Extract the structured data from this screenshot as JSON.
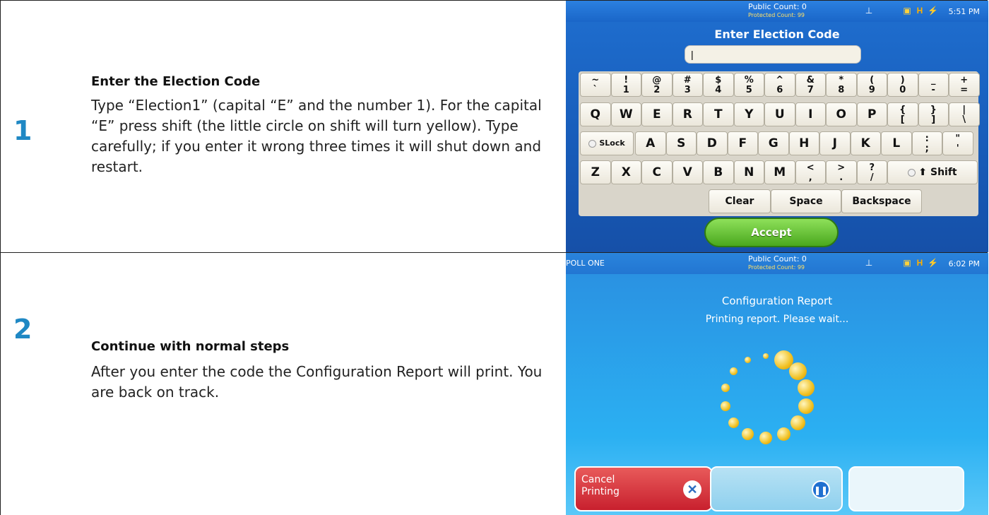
{
  "steps": [
    {
      "number": "1",
      "heading": "Enter the Election Code",
      "body": "Type “Election1” (capital “E” and the number 1). For the capital “E” press shift (the little circle on shift will turn yellow). Type carefully; if you enter it wrong three times it will shut down and restart."
    },
    {
      "number": "2",
      "heading": "Continue with normal steps",
      "body": "After you enter the code the Configuration Report will print. You are back on track."
    }
  ],
  "screen1": {
    "public_count": "Public Count: 0",
    "protected_count": "Protected Count: 99",
    "time": "5:51 PM",
    "title": "Enter Election Code",
    "input_value": "|",
    "keyboard": {
      "row1": [
        [
          "~",
          "`"
        ],
        [
          "!",
          "1"
        ],
        [
          "@",
          "2"
        ],
        [
          "#",
          "3"
        ],
        [
          "$",
          "4"
        ],
        [
          "%",
          "5"
        ],
        [
          "^",
          "6"
        ],
        [
          "&",
          "7"
        ],
        [
          "*",
          "8"
        ],
        [
          "(",
          "9"
        ],
        [
          ")",
          "0"
        ],
        [
          "_",
          "-"
        ],
        [
          "+",
          "="
        ]
      ],
      "row2": [
        "Q",
        "W",
        "E",
        "R",
        "T",
        "Y",
        "U",
        "I",
        "O",
        "P",
        [
          "{",
          "["
        ],
        [
          "}",
          "]"
        ],
        [
          "|",
          "\\"
        ]
      ],
      "row3_lock": "SLock",
      "row3": [
        "A",
        "S",
        "D",
        "F",
        "G",
        "H",
        "J",
        "K",
        "L",
        [
          ":",
          ";"
        ],
        [
          "\"",
          "'"
        ]
      ],
      "row4": [
        "Z",
        "X",
        "C",
        "V",
        "B",
        "N",
        "M",
        [
          "<",
          ","
        ],
        [
          ">",
          "."
        ],
        [
          "?",
          "/"
        ]
      ],
      "shift": "Shift",
      "clear": "Clear",
      "space": "Space",
      "backspace": "Backspace"
    },
    "accept": "Accept"
  },
  "screen2": {
    "poll": "POLL ONE",
    "public_count": "Public Count: 0",
    "protected_count": "Protected Count: 99",
    "time": "6:02 PM",
    "title": "Configuration Report",
    "status": "Printing report. Please wait...",
    "cancel_line1": "Cancel",
    "cancel_line2": "Printing",
    "colors": {
      "accent": "#1f88c4",
      "cancel": "#d8303a",
      "spinner": "#f0c020"
    }
  }
}
